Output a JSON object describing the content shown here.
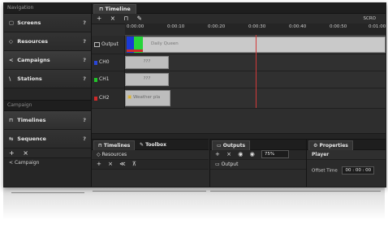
{
  "sidebar": {
    "header": "Navigation",
    "items": [
      {
        "icon": "▢",
        "label": "Screens",
        "help": "?"
      },
      {
        "icon": "◇",
        "label": "Resources",
        "help": "?"
      },
      {
        "icon": "<",
        "label": "Campaigns",
        "help": "?"
      },
      {
        "icon": "\\",
        "label": "Stations",
        "help": "?"
      }
    ],
    "sub_header": "Campaign",
    "sub_items": [
      {
        "icon": "⊓",
        "label": "Timelines",
        "help": "?"
      },
      {
        "icon": "⇆",
        "label": "Sequence",
        "help": "?"
      }
    ],
    "tools": [
      "+",
      "×"
    ],
    "campaign_label": "Campaign"
  },
  "timeline": {
    "tab": "Timeline",
    "tools": [
      "+",
      "×",
      "⊓",
      "✎"
    ],
    "scroll_label": "SCRO",
    "ticks": [
      "0:00:00",
      "0:00:10",
      "0:00:20",
      "0:00:30",
      "0:00:40",
      "0:00:50",
      "0:01:00"
    ],
    "rows": [
      {
        "label": "Output",
        "color": "#8a8a8a",
        "clip_text": "Daily Queen"
      },
      {
        "label": "CH0",
        "color": "#2a46d8",
        "clip_text": "???"
      },
      {
        "label": "CH1",
        "color": "#22c42a",
        "clip_text": "???"
      },
      {
        "label": "CH2",
        "color": "#d12a2a",
        "clip_text": "Weather pla"
      }
    ],
    "output_colors": [
      "#1a3ad6",
      "#26d43a",
      "#d12a8a"
    ]
  },
  "panels": {
    "left_tabs": [
      "Timelines",
      "Toolbox"
    ],
    "left_row": "Resources",
    "left_tools": [
      "+",
      "×",
      "≪",
      "⊼"
    ],
    "outputs_tab": "Outputs",
    "outputs_tools": [
      "+",
      "×",
      "◉",
      "◉"
    ],
    "outputs_zoom": "75%",
    "outputs_row": "Output",
    "properties_tab": "Properties",
    "properties_section": "Player",
    "offset_label": "Offset Time",
    "offset_value": "00 : 00 : 00"
  }
}
